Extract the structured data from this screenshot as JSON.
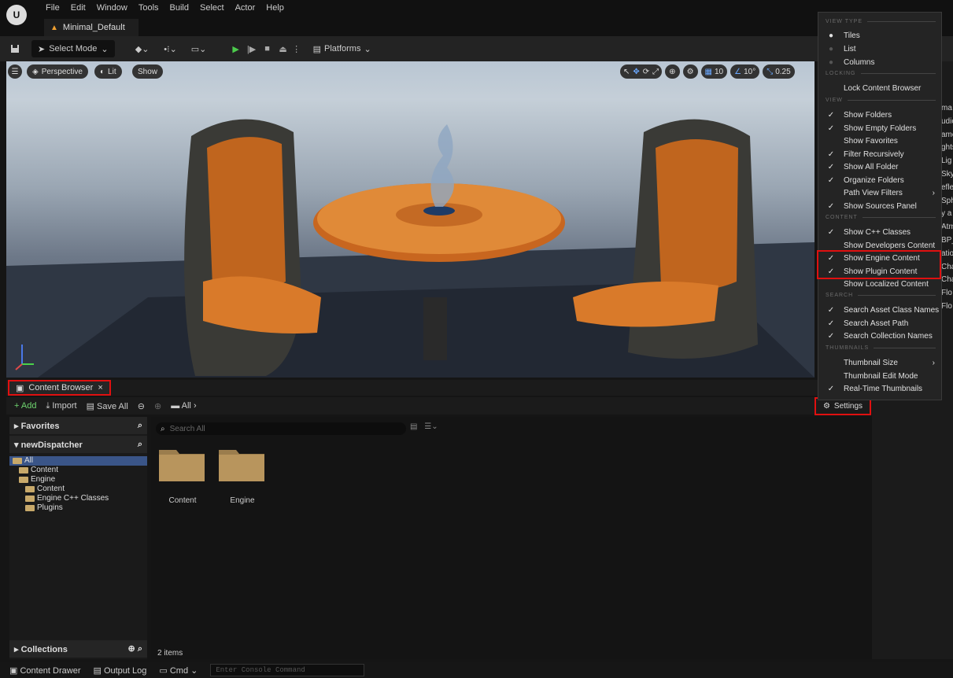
{
  "app": {
    "logo": "U",
    "menu": [
      "File",
      "Edit",
      "Window",
      "Tools",
      "Build",
      "Select",
      "Actor",
      "Help"
    ],
    "project_tab": "Minimal_Default"
  },
  "toolbar": {
    "select_mode": "Select Mode",
    "platforms": "Platforms"
  },
  "viewport": {
    "perspective": "Perspective",
    "lit": "Lit",
    "show": "Show",
    "grid_value": "10",
    "angle_value": "10°",
    "scale_value": "0.25"
  },
  "content_browser": {
    "tab_label": "Content Browser",
    "close": "×",
    "add": "+ Add",
    "import": "Import",
    "save_all": "Save All",
    "path_root": "All",
    "favorites": "Favorites",
    "project": "newDispatcher",
    "tree": [
      "All",
      "Content",
      "Engine",
      "Content",
      "Engine C++ Classes",
      "Plugins"
    ],
    "search_placeholder": "Search All",
    "items": [
      {
        "label": "Content"
      },
      {
        "label": "Engine"
      }
    ],
    "collections": "Collections",
    "item_count": "2 items",
    "settings": "Settings"
  },
  "right_panel": {
    "fragments": [
      "ma",
      "udio",
      "ame",
      "ghts",
      "Lig",
      "Sky",
      "efle",
      "Sph",
      "y a",
      "Atm",
      "BP_",
      "atio",
      "Cha",
      "Cha",
      "Flo",
      "Flo"
    ]
  },
  "status": {
    "content_drawer": "Content Drawer",
    "output_log": "Output Log",
    "cmd": "Cmd",
    "cmd_placeholder": "Enter Console Command"
  },
  "settings_menu": {
    "headers": {
      "view_type": "VIEW TYPE",
      "locking": "LOCKING",
      "view": "VIEW",
      "content": "CONTENT",
      "search": "SEARCH",
      "thumbnails": "THUMBNAILS"
    },
    "items": {
      "tiles": "Tiles",
      "list": "List",
      "columns": "Columns",
      "lock": "Lock Content Browser",
      "show_folders": "Show Folders",
      "show_empty": "Show Empty Folders",
      "show_fav": "Show Favorites",
      "filter_rec": "Filter Recursively",
      "show_all_folder": "Show All Folder",
      "organize": "Organize Folders",
      "path_view": "Path View Filters",
      "show_sources": "Show Sources Panel",
      "cpp": "Show C++ Classes",
      "dev": "Show Developers Content",
      "engine": "Show Engine Content",
      "plugin": "Show Plugin Content",
      "localized": "Show Localized Content",
      "search_class": "Search Asset Class Names",
      "search_path": "Search Asset Path",
      "search_coll": "Search Collection Names",
      "thumb_size": "Thumbnail Size",
      "thumb_edit": "Thumbnail Edit Mode",
      "realtime": "Real-Time Thumbnails"
    }
  }
}
